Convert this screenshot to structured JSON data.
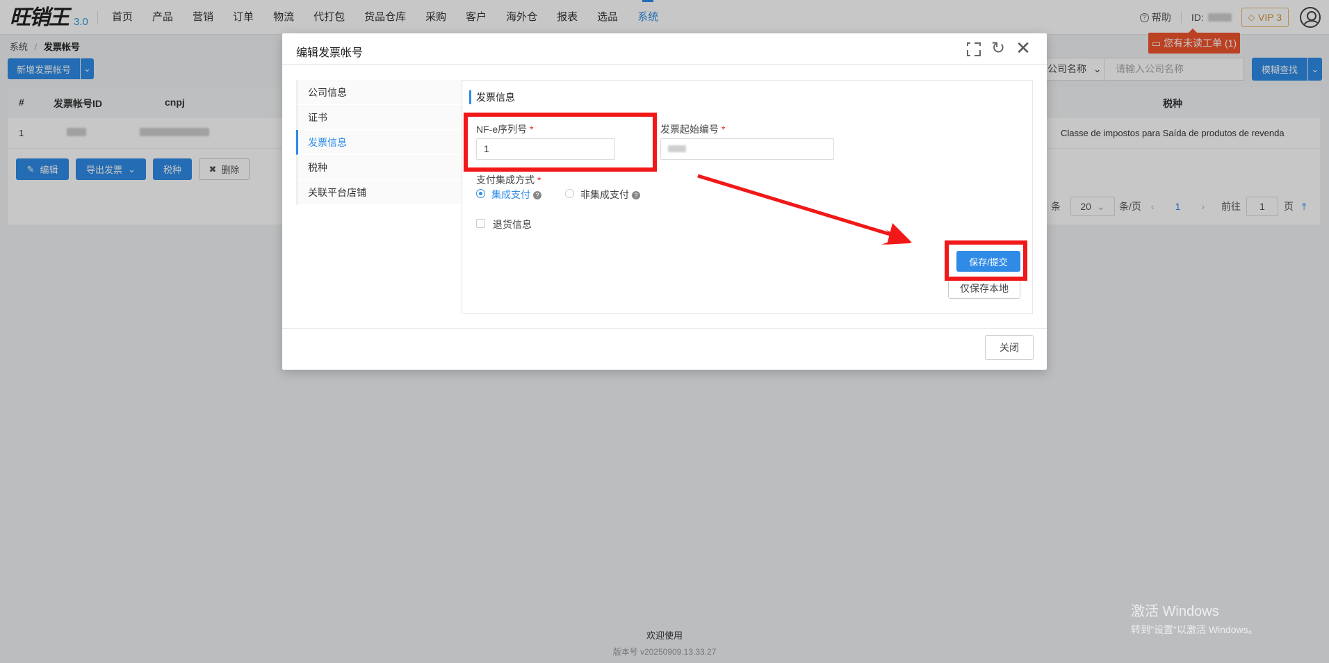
{
  "app": {
    "brand": "旺销王",
    "version": "3.0"
  },
  "nav": {
    "items": [
      "首页",
      "产品",
      "营销",
      "订单",
      "物流",
      "代打包",
      "货品仓库",
      "采购",
      "客户",
      "海外仓",
      "报表",
      "选品",
      "系统"
    ],
    "active_index": 12
  },
  "topright": {
    "help_label": "帮助",
    "id_label": "ID:",
    "vip_label": "VIP 3",
    "ticket_label": "您有未读工单 (1)"
  },
  "breadcrumb": {
    "parent": "系统",
    "separator": "/",
    "current": "发票帐号"
  },
  "toolbar": {
    "add_label": "新增发票帐号",
    "search_select": "公司名称",
    "search_placeholder": "请输入公司名称",
    "fuzzy_search_label": "模糊查找"
  },
  "table": {
    "headers": [
      "#",
      "发票帐号ID",
      "cnpj",
      "税种"
    ],
    "row": {
      "index": "1",
      "tax_type": "Classe de impostos para Saída de produtos de revenda"
    },
    "actions": {
      "edit": "编辑",
      "export": "导出发票",
      "tax": "税种",
      "delete": "删除"
    }
  },
  "pager": {
    "unit": "条",
    "page_size": "20",
    "per_page": "条/页",
    "current_page": "1",
    "goto_label": "前往",
    "goto_value": "1",
    "page_suffix": "页"
  },
  "footer": {
    "welcome": "欢迎使用",
    "version": "版本号 v20250909.13.33.27"
  },
  "watermark": {
    "line1": "激活 Windows",
    "line2": "转到\"设置\"以激活 Windows。"
  },
  "dialog": {
    "title": "编辑发票帐号",
    "sidebar": [
      "公司信息",
      "证书",
      "发票信息",
      "税种",
      "关联平台店铺"
    ],
    "sidebar_active": 2,
    "section_title": "发票信息",
    "nfe_label": "NF-e序列号",
    "nfe_value": "1",
    "start_no_label": "发票起始编号",
    "payment_label": "支付集成方式",
    "payment_options": [
      "集成支付",
      "非集成支付"
    ],
    "payment_selected": 0,
    "return_label": "退货信息",
    "save_submit": "保存/提交",
    "save_local": "仅保存本地",
    "close": "关闭"
  },
  "colors": {
    "primary": "#2f8be6",
    "highlight": "#f01818",
    "ticket": "#f0542d",
    "vip": "#d39531"
  }
}
